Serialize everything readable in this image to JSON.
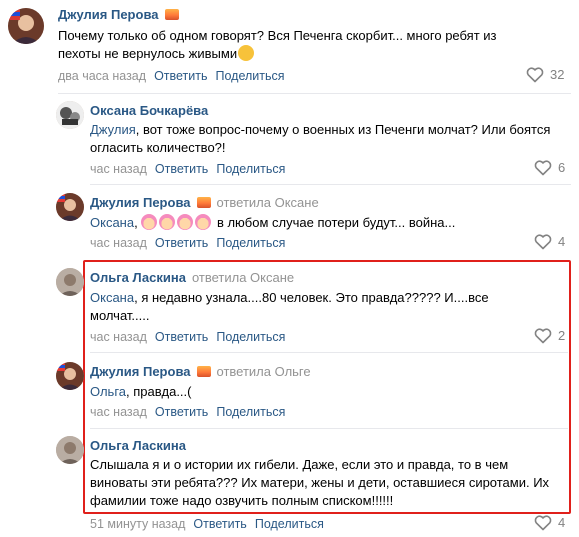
{
  "like_color": "#828282",
  "accent": "#2a5885",
  "highlight_color": "#e0201b",
  "comments": [
    {
      "author": "Джулия Перова",
      "has_badge": true,
      "reply_to": "",
      "mention": "",
      "text": "Почему только об одном говорят? Вся Печенга скорбит... много ребят из пехоты не вернулось живыми",
      "time": "два часа назад",
      "reply_label": "Ответить",
      "share_label": "Поделиться",
      "likes": "32"
    },
    {
      "author": "Оксана Бочкарёва",
      "has_badge": false,
      "reply_to": "",
      "mention": "Джулия",
      "text": ", вот тоже вопрос-почему о военных из Печенги молчат? Или боятся огласить количество?!",
      "time": "час назад",
      "reply_label": "Ответить",
      "share_label": "Поделиться",
      "likes": "6"
    },
    {
      "author": "Джулия Перова",
      "has_badge": true,
      "reply_to": "ответила Оксане",
      "mention": "Оксана",
      "text_after_emoji": "в любом случае потери будут... война...",
      "time": "час назад",
      "reply_label": "Ответить",
      "share_label": "Поделиться",
      "likes": "4"
    },
    {
      "author": "Ольга Ласкина",
      "has_badge": false,
      "reply_to": "ответила Оксане",
      "mention": "Оксана",
      "text": ", я недавно узнала....80 человек. Это правда????? И....все молчат.....",
      "time": "час назад",
      "reply_label": "Ответить",
      "share_label": "Поделиться",
      "likes": "2"
    },
    {
      "author": "Джулия Перова",
      "has_badge": true,
      "reply_to": "ответила Ольге",
      "mention": "Ольга",
      "text": ", правда...(",
      "time": "час назад",
      "reply_label": "Ответить",
      "share_label": "Поделиться",
      "likes": ""
    },
    {
      "author": "Ольга Ласкина",
      "has_badge": false,
      "reply_to": "",
      "mention": "",
      "text": "Слышала я и о истории их гибели. Даже, если это и правда, то в чем виноваты эти ребята??? Их матери, жены и дети, оставшиеся сиротами. Их фамилии тоже надо озвучить полным списком!!!!!!",
      "time": "51 минуту назад",
      "reply_label": "Ответить",
      "share_label": "Поделиться",
      "likes": "4"
    }
  ]
}
